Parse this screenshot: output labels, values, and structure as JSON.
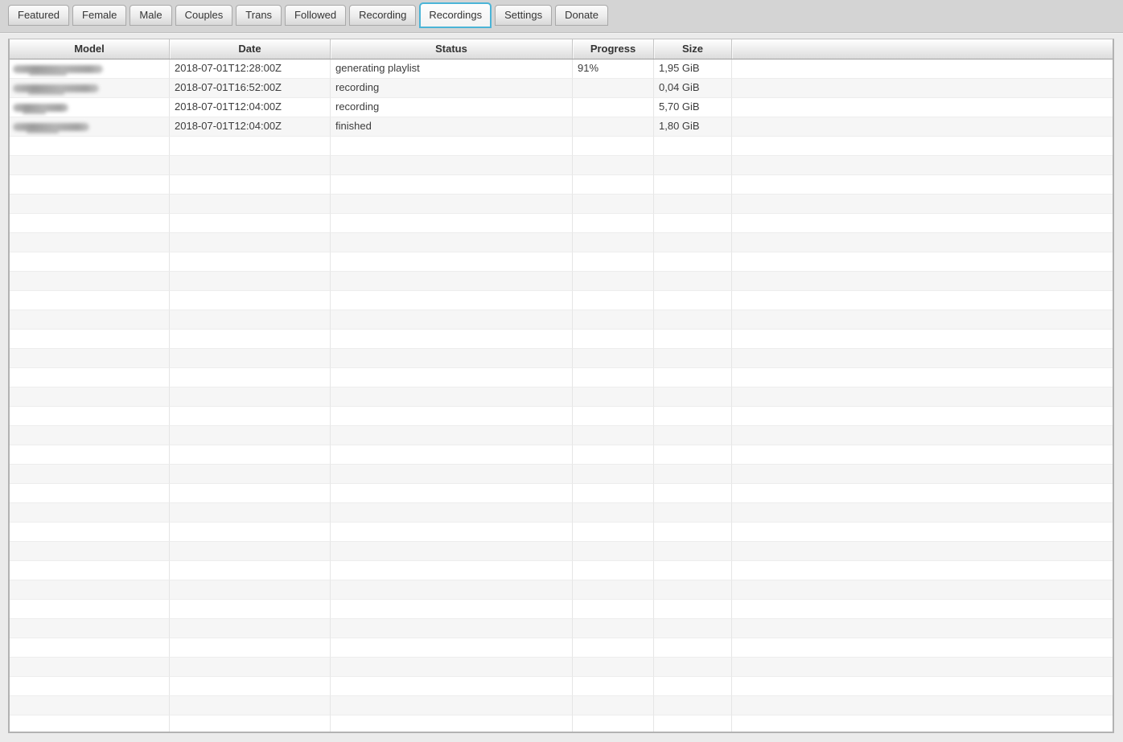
{
  "tabs": {
    "items": [
      {
        "label": "Featured",
        "selected": false
      },
      {
        "label": "Female",
        "selected": false
      },
      {
        "label": "Male",
        "selected": false
      },
      {
        "label": "Couples",
        "selected": false
      },
      {
        "label": "Trans",
        "selected": false
      },
      {
        "label": "Followed",
        "selected": false
      },
      {
        "label": "Recording",
        "selected": false
      },
      {
        "label": "Recordings",
        "selected": true
      },
      {
        "label": "Settings",
        "selected": false
      },
      {
        "label": "Donate",
        "selected": false
      }
    ]
  },
  "table": {
    "columns": [
      {
        "label": "Model"
      },
      {
        "label": "Date"
      },
      {
        "label": "Status"
      },
      {
        "label": "Progress"
      },
      {
        "label": "Size"
      },
      {
        "label": ""
      }
    ],
    "rows": [
      {
        "model": "",
        "model_redacted": true,
        "model_blob_width": 112,
        "date": "2018-07-01T12:28:00Z",
        "status": "generating playlist",
        "progress": "91%",
        "size": "1,95 GiB"
      },
      {
        "model": "",
        "model_redacted": true,
        "model_blob_width": 107,
        "date": "2018-07-01T16:52:00Z",
        "status": "recording",
        "progress": "",
        "size": "0,04 GiB"
      },
      {
        "model": "",
        "model_redacted": true,
        "model_blob_width": 69,
        "date": "2018-07-01T12:04:00Z",
        "status": "recording",
        "progress": "",
        "size": "5,70 GiB"
      },
      {
        "model": "",
        "model_redacted": true,
        "model_blob_width": 95,
        "date": "2018-07-01T12:04:00Z",
        "status": "finished",
        "progress": "",
        "size": "1,80 GiB"
      }
    ],
    "empty_row_count": 31
  },
  "colors": {
    "selected_tab_border": "#4bb4d7",
    "tab_strip_bg": "#d4d4d4",
    "content_bg": "#ebebeb",
    "header_gradient_top": "#ffffff",
    "header_gradient_bottom": "#dcdcdc",
    "row_alt_bg": "#f6f6f6",
    "table_border": "#b2b2b2",
    "text": "#3c3c3c"
  }
}
